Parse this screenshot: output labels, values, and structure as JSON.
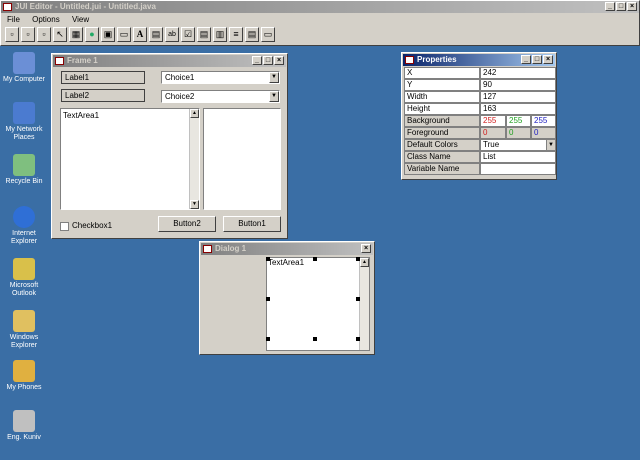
{
  "main_window": {
    "title": "JUI Editor - Untitled.jui - Untitled.java",
    "menu": [
      "File",
      "Options",
      "View"
    ],
    "toolbar_icons": [
      "new-icon",
      "open-icon",
      "save-icon",
      "pointer-icon",
      "grid-icon",
      "globe-icon",
      "panel-icon",
      "label-icon",
      "text-icon",
      "textfield-icon",
      "checkbox-icon",
      "list-icon",
      "choice-icon",
      "scrollbar-icon",
      "textarea-icon",
      "button-icon"
    ],
    "toolbar_label_glyph": "A",
    "toolbar_textfield_glyph": "ab"
  },
  "desktop_icons": [
    {
      "label": "My Computer",
      "color": "#6b8fd6"
    },
    {
      "label": "My Network Places",
      "color": "#4b7bd0"
    },
    {
      "label": "Recycle Bin",
      "color": "#7fbf7f"
    },
    {
      "label": "Internet Explorer",
      "color": "#2f6fd6"
    },
    {
      "label": "Microsoft Outlook",
      "color": "#d9c04a"
    },
    {
      "label": "Windows Explorer",
      "color": "#e0c060"
    },
    {
      "label": "My Phones",
      "color": "#e0b040"
    },
    {
      "label": "Eng. Kuniv",
      "color": "#c0c0c0"
    }
  ],
  "frame1": {
    "title": "Frame 1",
    "label1": "Label1",
    "label2": "Label2",
    "choice1": "Choice1",
    "choice2": "Choice2",
    "textarea": "TextArea1",
    "checkbox": "Checkbox1",
    "button2": "Button2",
    "button1": "Button1"
  },
  "dialog1": {
    "title": "Dialog 1",
    "textarea": "TextArea1"
  },
  "properties": {
    "title": "Properties",
    "rows": [
      {
        "name": "X",
        "value": "242"
      },
      {
        "name": "Y",
        "value": "90"
      },
      {
        "name": "Width",
        "value": "127"
      },
      {
        "name": "Height",
        "value": "163"
      }
    ],
    "background": {
      "name": "Background",
      "r": "255",
      "g": "255",
      "b": "255"
    },
    "foreground": {
      "name": "Foreground",
      "r": "0",
      "g": "0",
      "b": "0"
    },
    "default_colors": {
      "name": "Default Colors",
      "value": "True"
    },
    "class_name": {
      "name": "Class Name",
      "value": "List"
    },
    "variable_name": {
      "name": "Variable Name",
      "value": ""
    },
    "colors": {
      "red": "#d02020",
      "green": "#20a020",
      "blue": "#2020c0"
    }
  }
}
